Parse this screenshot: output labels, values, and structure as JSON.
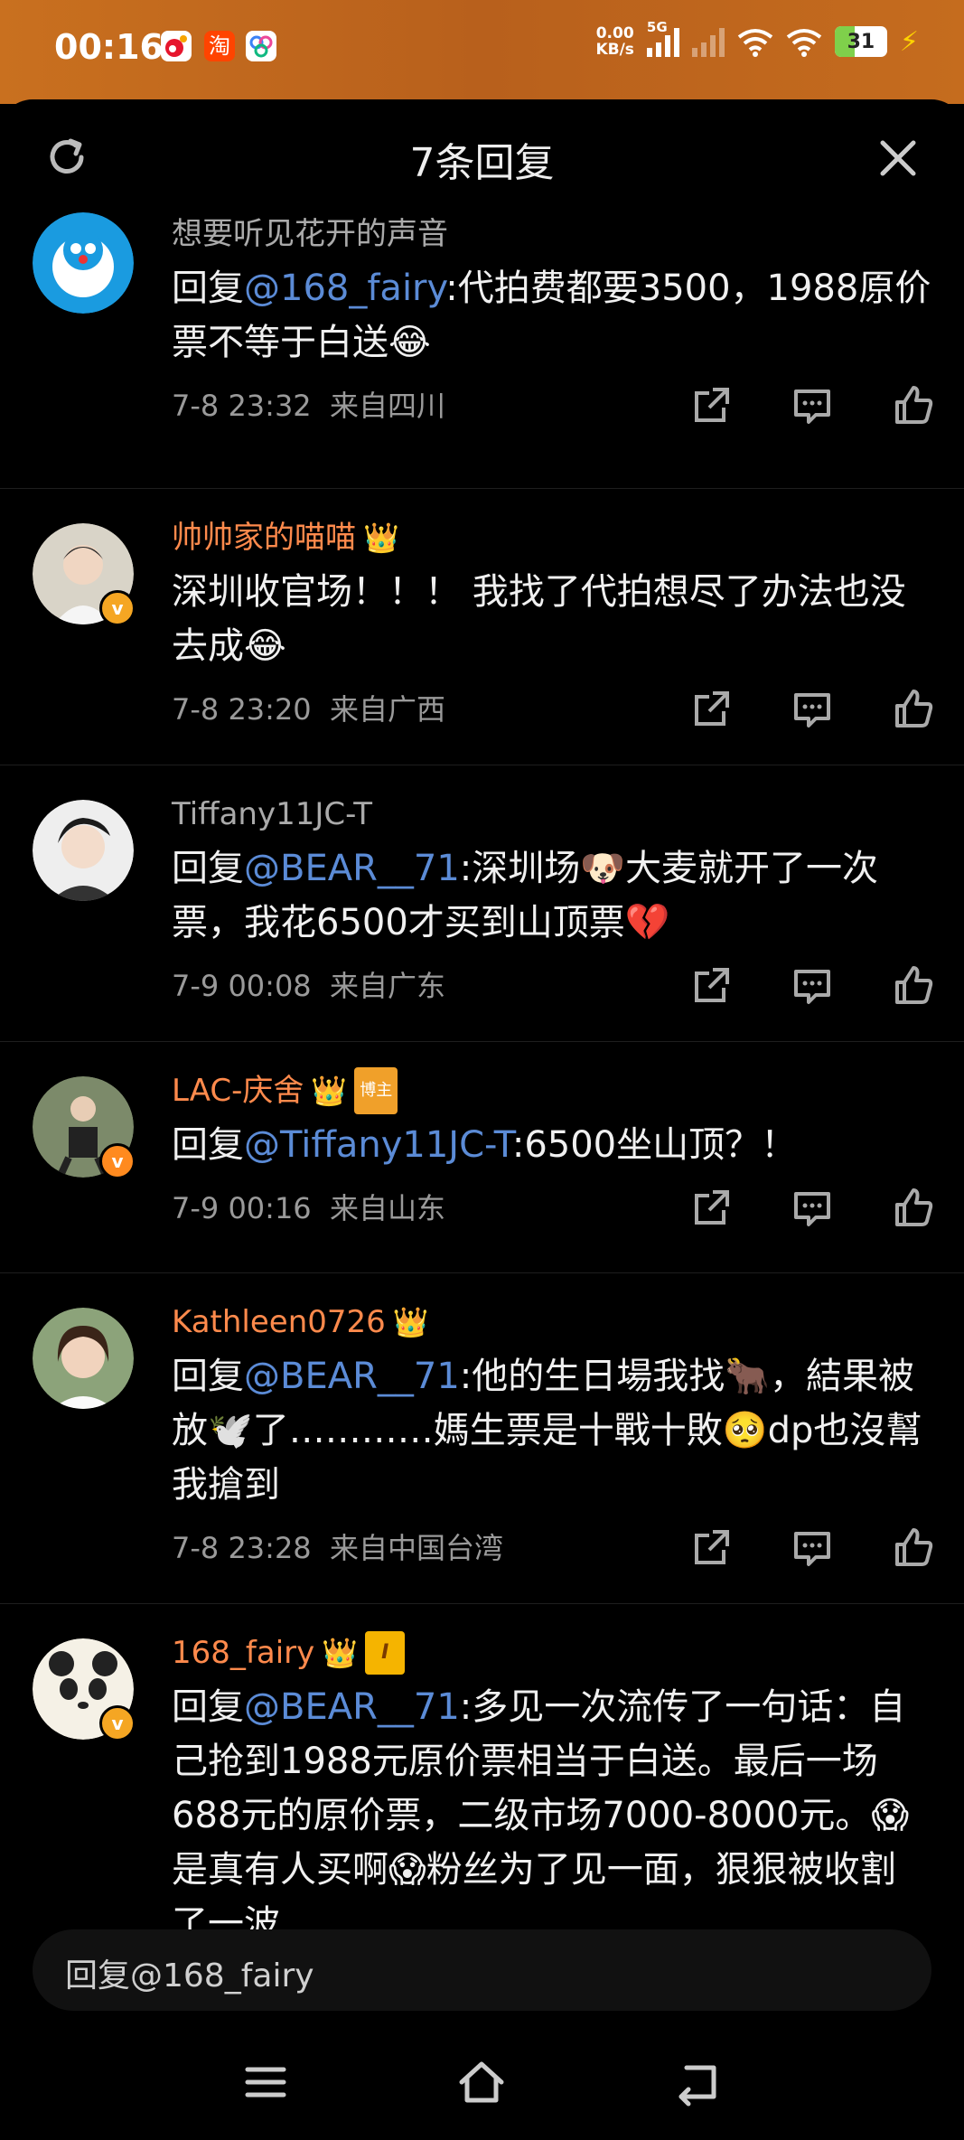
{
  "status_bar": {
    "time": "00:16",
    "net_speed_top": "0.00",
    "net_speed_bottom": "KB/s",
    "network": "5G",
    "battery": "31"
  },
  "header": {
    "title": "7条回复"
  },
  "comments": [
    {
      "name": "想要听见花开的声音",
      "name_color": "gray",
      "prefix": "回复",
      "mention": "@168_fairy",
      "text": ":代拍费都要3500，1988原价票不等于白送😂",
      "time": "7-8 23:32",
      "location": "来自四川"
    },
    {
      "name": "帅帅家的喵喵",
      "name_color": "orange",
      "prefix": "",
      "mention": "",
      "text": "深圳收官场！！！ 我找了代拍想尽了办法也没去成😂",
      "time": "7-8 23:20",
      "location": "来自广西"
    },
    {
      "name": "Tiffany11JC-T",
      "name_color": "gray",
      "prefix": "回复",
      "mention": "@BEAR__71",
      "text": ":深圳场🐶大麦就开了一次票，我花6500才买到山顶票💔",
      "time": "7-9 00:08",
      "location": "来自广东"
    },
    {
      "name": "LAC-庆舍",
      "name_color": "orange",
      "tag": "博主",
      "prefix": "回复",
      "mention": "@Tiffany11JC-T",
      "text": ":6500坐山顶？！",
      "time": "7-9 00:16",
      "location": "来自山东"
    },
    {
      "name": "Kathleen0726",
      "name_color": "orange",
      "prefix": "回复",
      "mention": "@BEAR__71",
      "text": ":他的生日場我找🐂，結果被放🕊️了…………媽生票是十戰十敗🥺dp也沒幫我搶到",
      "time": "7-8 23:28",
      "location": "来自中国台湾"
    },
    {
      "name": "168_fairy",
      "name_color": "orange",
      "tag": "I",
      "prefix": "回复",
      "mention": "@BEAR__71",
      "text": ":多见一次流传了一句话：自己抢到1988元原价票相当于白送。最后一场688元的原价票，二级市场7000-8000元。😱是真有人买啊😱粉丝为了见一面，狠狠被收割了一波",
      "time": "",
      "location": ""
    }
  ],
  "reply_box": {
    "placeholder": "回复@168_fairy"
  },
  "colors": {
    "mention": "#5b8bd6",
    "vip_name": "#ff8a4c",
    "status_bar": "#c9701f"
  }
}
